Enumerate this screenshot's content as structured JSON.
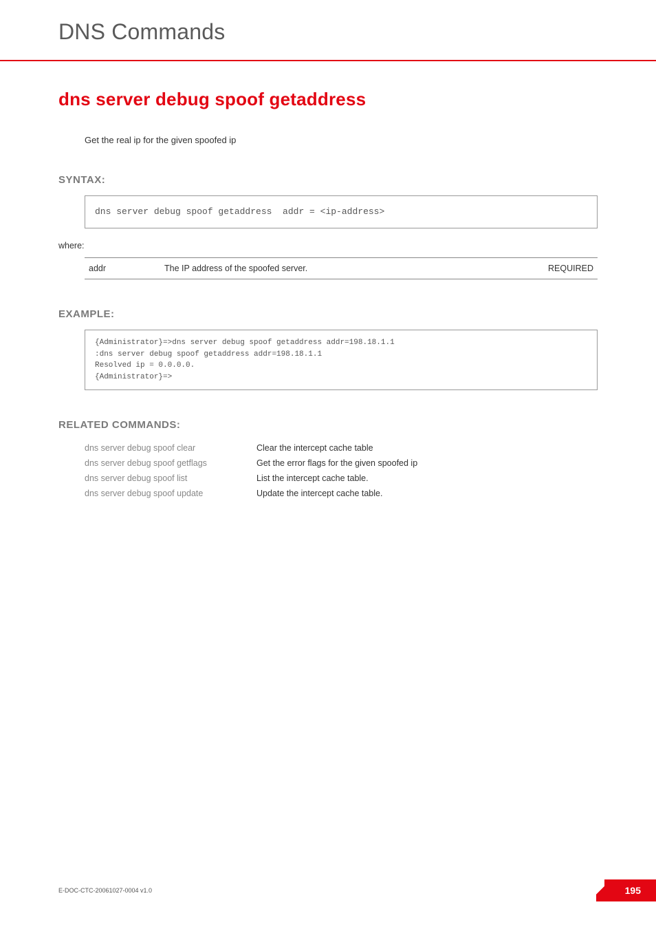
{
  "header": {
    "chapter_title": "DNS Commands"
  },
  "command": {
    "title": "dns server debug spoof getaddress",
    "description": "Get the real ip for the given spoofed ip"
  },
  "syntax": {
    "label": "SYNTAX:",
    "code": "dns server debug spoof getaddress  addr = <ip-address>",
    "where": "where:",
    "params": [
      {
        "name": "addr",
        "desc": "The IP address of the spoofed server.",
        "req": "REQUIRED"
      }
    ]
  },
  "example": {
    "label": "EXAMPLE:",
    "code": "{Administrator}=>dns server debug spoof getaddress addr=198.18.1.1\n:dns server debug spoof getaddress addr=198.18.1.1\nResolved ip = 0.0.0.0.\n{Administrator}=>"
  },
  "related": {
    "label": "RELATED COMMANDS:",
    "rows": [
      {
        "cmd": "dns server debug spoof clear",
        "desc": "Clear the intercept cache table"
      },
      {
        "cmd": "dns server debug spoof getflags",
        "desc": "Get the error flags for the given spoofed ip"
      },
      {
        "cmd": "dns server debug spoof list",
        "desc": "List the intercept cache table."
      },
      {
        "cmd": "dns server debug spoof update",
        "desc": "Update the intercept cache table."
      }
    ]
  },
  "footer": {
    "doc_id": "E-DOC-CTC-20061027-0004 v1.0",
    "page_number": "195"
  }
}
